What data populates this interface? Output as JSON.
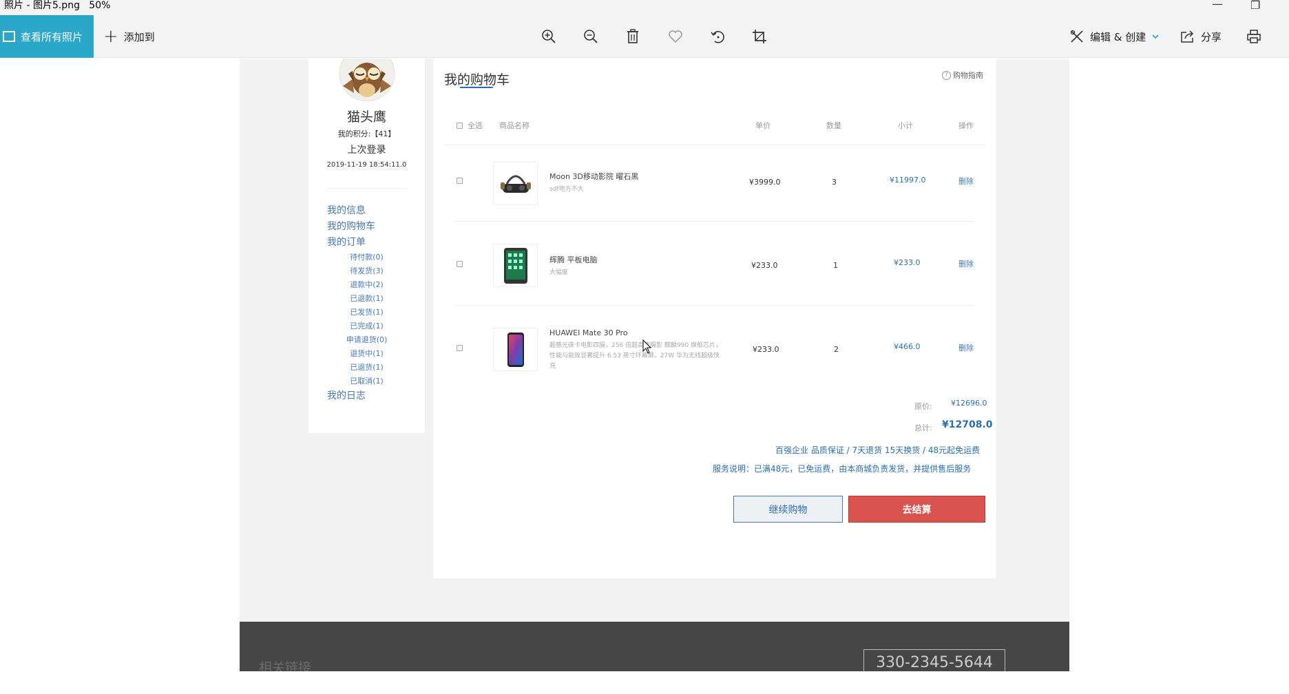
{
  "window": {
    "title": "照片 - 图片5.png   50%",
    "minimize": "—",
    "restore": "❐"
  },
  "toolbar": {
    "all_photos": "查看所有照片",
    "add_to": "添加到",
    "edit_create": "编辑 & 创建",
    "share": "分享",
    "tools": [
      "zoom-in-icon",
      "zoom-out-icon",
      "delete-icon",
      "favorite-icon",
      "rotate-icon",
      "crop-icon",
      "print-icon"
    ]
  },
  "sidebar": {
    "username": "猫头鹰",
    "score": "我的积分:【41】",
    "last_login_label": "上次登录",
    "last_login_time": "2019-11-19 18:54:11.0",
    "nav": {
      "my_info": "我的信息",
      "my_cart": "我的购物车",
      "my_orders": "我的订单",
      "order_status": [
        "待付款(0)",
        "待发货(3)",
        "退款中(2)",
        "已退款(1)",
        "已发货(1)",
        "已完成(1)",
        "申请退货(0)",
        "退货中(1)",
        "已退货(1)",
        "已取消(1)"
      ],
      "my_log": "我的日志"
    }
  },
  "cart": {
    "title": "我的购物车",
    "guide": "购物指南",
    "headers": {
      "select_all": "全选",
      "product_name": "商品名称",
      "unit_price": "单价",
      "quantity": "数量",
      "subtotal": "小计",
      "action": "操作"
    },
    "items": [
      {
        "name": "Moon 3D移动影院 曜石黑",
        "desc": "sdf地方不大",
        "price": "¥3999.0",
        "qty": "3",
        "subtotal": "¥11997.0",
        "action": "删除"
      },
      {
        "name": "辉腾 平板电脑",
        "desc": "大幅度",
        "price": "¥233.0",
        "qty": "1",
        "subtotal": "¥233.0",
        "action": "删除"
      },
      {
        "name": "HUAWEI Mate 30 Pro",
        "desc": "超感光徕卡电影四摄，256 倍超高速摄影 麒麟990 旗舰芯片，性能与能效显著提升 6.53 英寸环幕屏，27W 华为无线超级快充",
        "price": "¥233.0",
        "qty": "2",
        "subtotal": "¥466.0",
        "action": "删除"
      }
    ],
    "original_label": "原价:",
    "original_value": "¥12696.0",
    "total_label": "总计:",
    "total_value": "¥12708.0",
    "service_1": "百强企业 品质保证 / 7天退货 15天换货 / 48元起免运费",
    "service_2": "服务说明：已满48元，已免运费，由本商城负责发货，并提供售后服务",
    "continue_label": "继续购物",
    "checkout_label": "去结算"
  },
  "footer": {
    "links_label": "相关链接",
    "phone": "330-2345-5644"
  },
  "colors": {
    "accent": "#2aa7c9",
    "link": "#4778b8",
    "price_blue": "#2a6eb0",
    "checkout_red": "#d9534f",
    "footer_bg": "#464646"
  }
}
